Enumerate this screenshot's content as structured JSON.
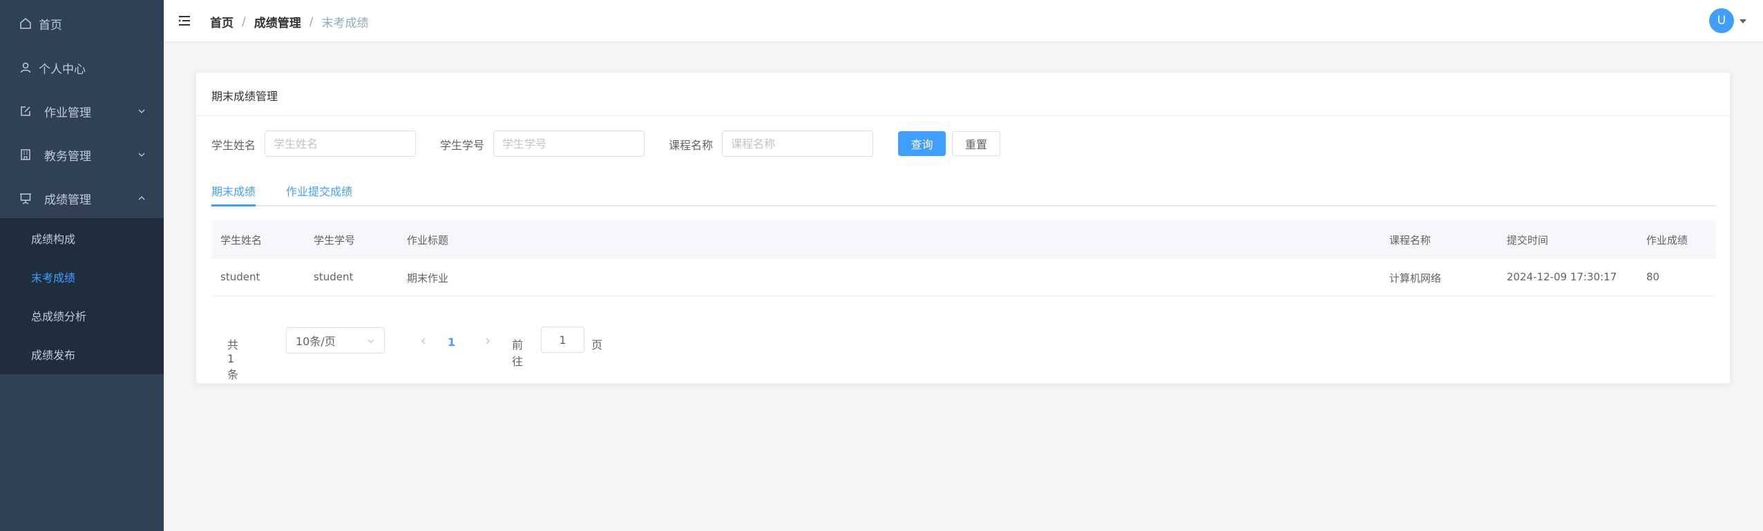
{
  "sidebar": {
    "items": [
      {
        "label": "首页",
        "icon": "home-icon"
      },
      {
        "label": "个人中心",
        "icon": "user-icon"
      },
      {
        "label": "作业管理",
        "icon": "edit-icon"
      },
      {
        "label": "教务管理",
        "icon": "office-building-icon"
      },
      {
        "label": "成绩管理",
        "icon": "presentation-icon"
      }
    ],
    "submenu": [
      "成绩构成",
      "末考成绩",
      "总成绩分析",
      "成绩发布"
    ],
    "active_color": "#409eff",
    "background": "#304156"
  },
  "header": {
    "breadcrumb": [
      "首页",
      "成绩管理",
      "末考成绩"
    ],
    "separator": "/",
    "avatar_letter": "U"
  },
  "card": {
    "title": "期末成绩管理",
    "search": {
      "name_label": "学生姓名",
      "name_placeholder": "学生姓名",
      "id_label": "学生学号",
      "id_placeholder": "学生学号",
      "course_label": "课程名称",
      "course_placeholder": "课程名称",
      "query_button": "查询",
      "reset_button": "重置"
    },
    "tabs": [
      "期末成绩",
      "作业提交成绩"
    ],
    "table": {
      "headers": [
        "学生姓名",
        "学生学号",
        "作业标题",
        "课程名称",
        "提交时间",
        "作业成绩"
      ],
      "rows": [
        [
          "student",
          "student",
          "期末作业",
          "计算机网络",
          "2024-12-09 17:30:17",
          "80"
        ]
      ]
    },
    "pagination": {
      "total": "共 1 条",
      "page_size": "10条/页",
      "current_page": "1",
      "goto_label": "前往",
      "goto_value": "1",
      "page_unit": "页"
    }
  }
}
